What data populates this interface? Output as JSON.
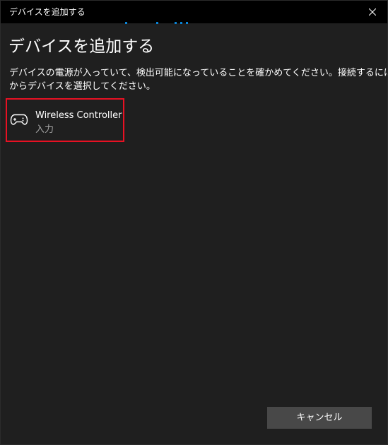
{
  "window": {
    "title": "デバイスを追加する"
  },
  "dialog": {
    "heading": "デバイスを追加する",
    "instructions": [
      "デバイスの電源が入っていて、検出可能になっていることを確かめてください。接続するには、以下",
      "からデバイスを選択してください。"
    ]
  },
  "devices": [
    {
      "name": "Wireless Controller",
      "type": "入力",
      "icon": "gamepad-icon",
      "selected": true
    }
  ],
  "buttons": {
    "cancel": "キャンセル"
  },
  "colors": {
    "background": "#1f1f1f",
    "titlebar": "#000000",
    "accent": "#0a84d6",
    "selection_outline": "#e81123",
    "button": "#484848",
    "secondary_text": "#a6a6a6"
  },
  "icons": [
    "close-icon",
    "gamepad-icon"
  ]
}
